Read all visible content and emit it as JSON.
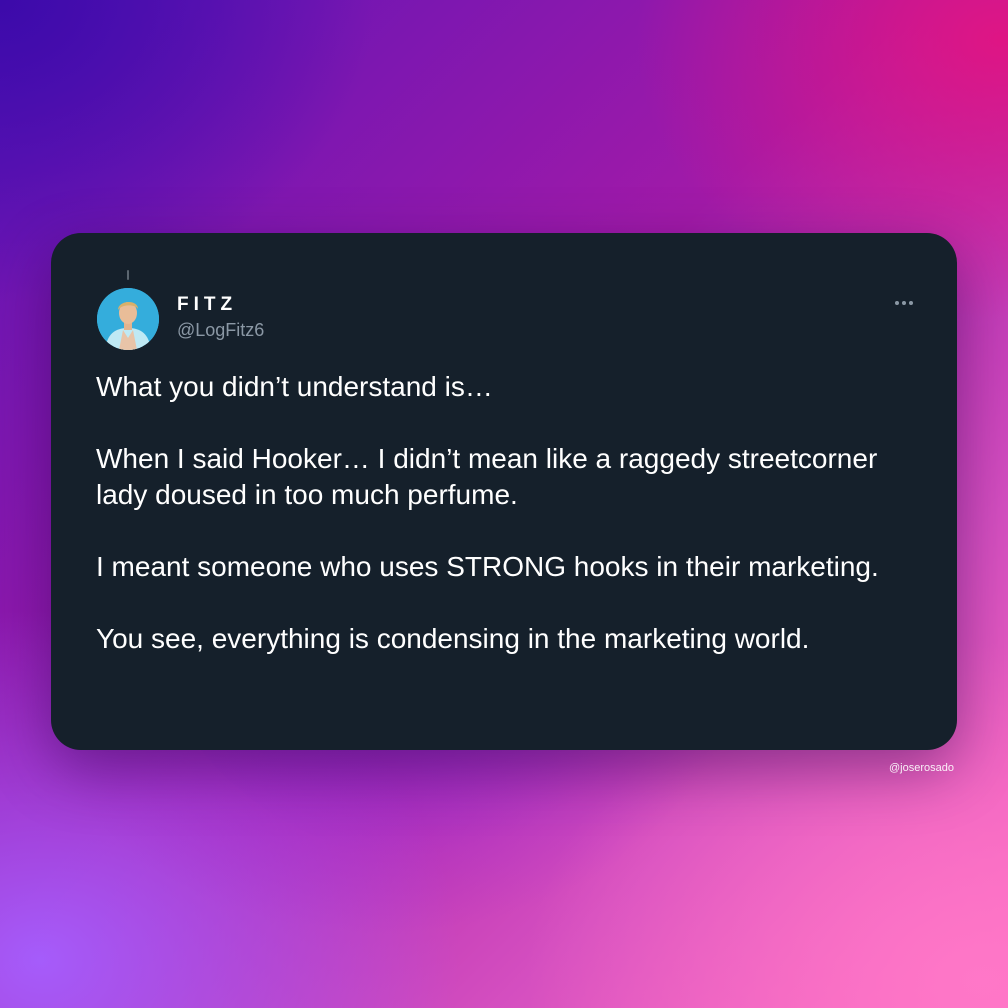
{
  "tweet": {
    "display_name": "FITZ",
    "handle": "@LogFitz6",
    "more_icon": "ellipsis-horizontal-icon",
    "avatar_icon": "profile-photo",
    "paragraphs": [
      "What you didn’t understand is…",
      "When I said Hooker… I didn’t mean like a raggedy streetcorner lady doused in too much perfume.",
      "I meant someone who uses STRONG hooks in their marketing.",
      "You see, everything is condensing in the marketing world."
    ]
  },
  "watermark": "@joserosado",
  "colors": {
    "card_background": "#15202b",
    "text_primary": "#ffffff",
    "text_secondary": "#8b98a5",
    "gradient_top_left": "#3c0aaa",
    "gradient_top_right": "#e11482",
    "gradient_bottom_right": "#ff6cc0",
    "gradient_bottom_left": "#a55fff"
  }
}
